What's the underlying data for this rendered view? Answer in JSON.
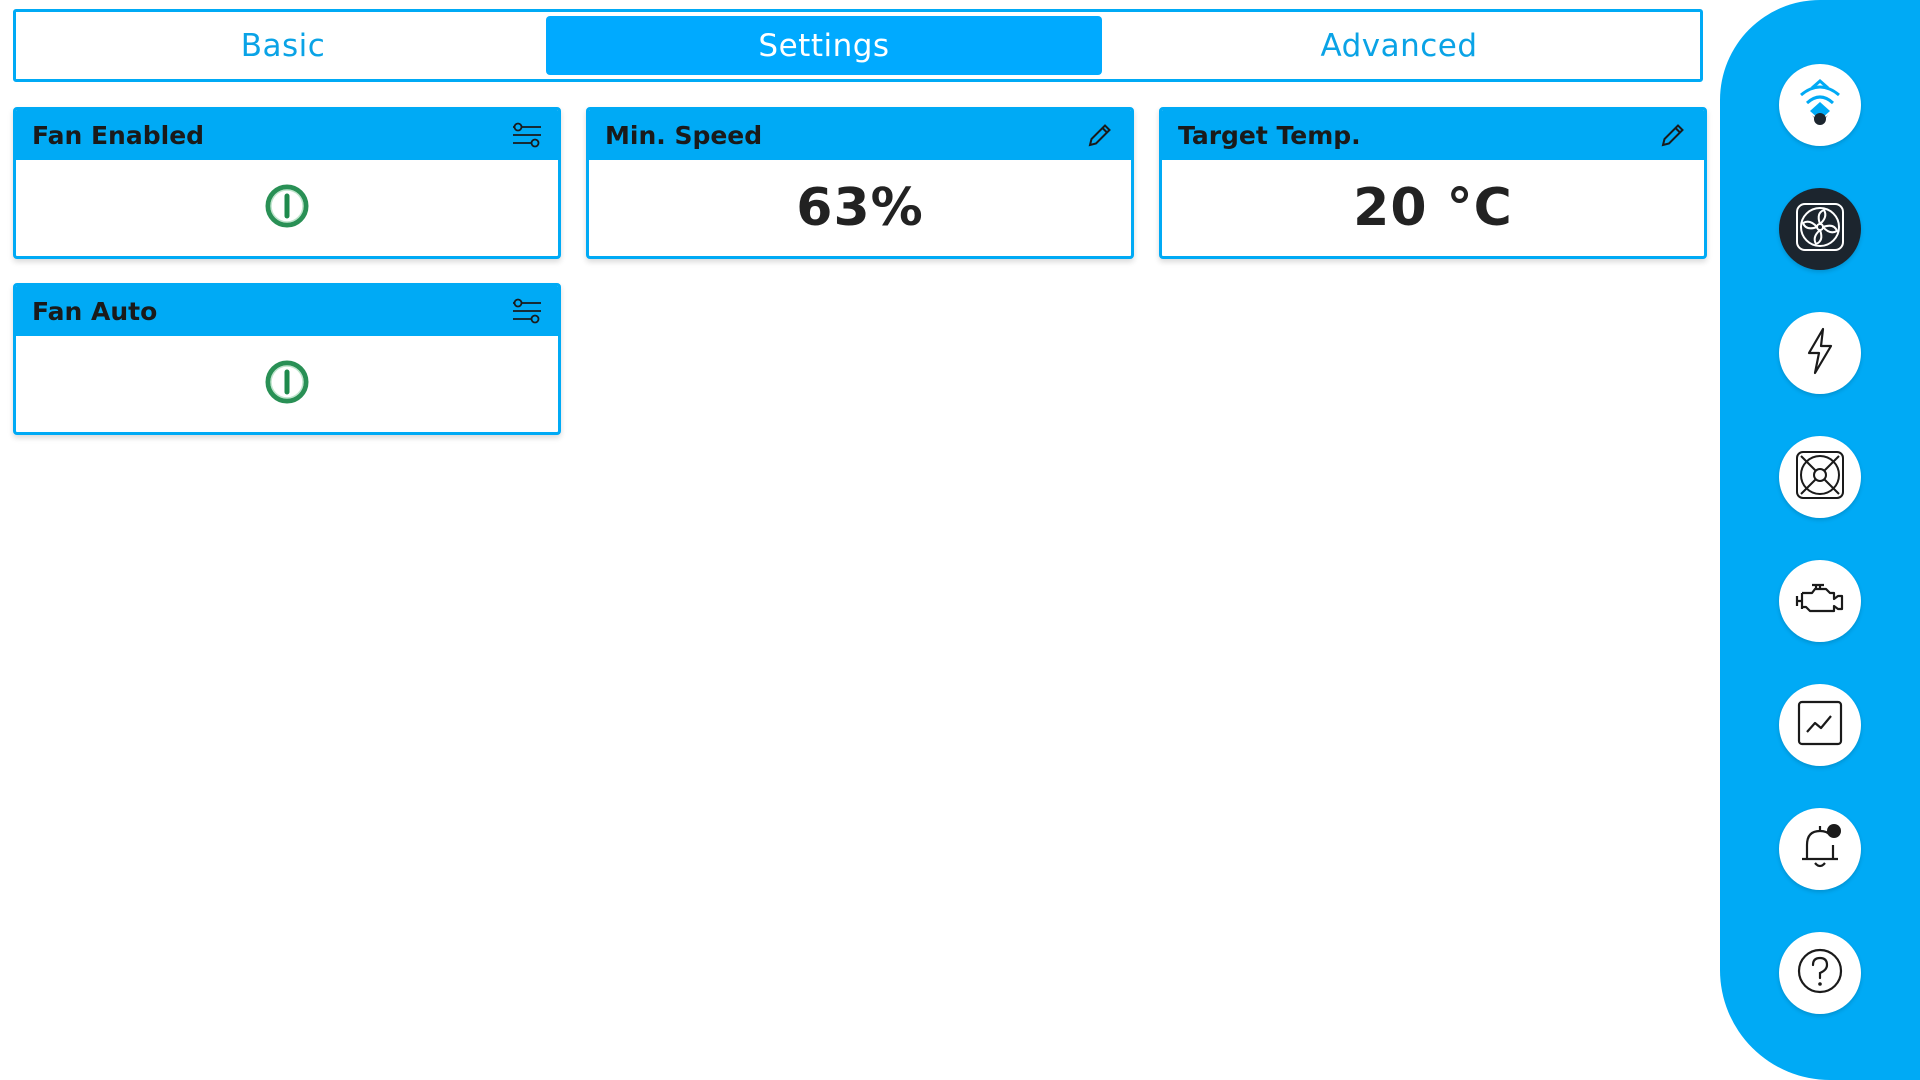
{
  "tabs": [
    {
      "label": "Basic",
      "active": false
    },
    {
      "label": "Settings",
      "active": true
    },
    {
      "label": "Advanced",
      "active": false
    }
  ],
  "cards": {
    "fan_enabled": {
      "title": "Fan Enabled",
      "state": "on",
      "icon": "sliders-icon"
    },
    "min_speed": {
      "title": "Min. Speed",
      "value": "63%",
      "icon": "pencil-icon"
    },
    "target_temp": {
      "title": "Target Temp.",
      "value": "20 °C",
      "icon": "pencil-icon"
    },
    "fan_auto": {
      "title": "Fan Auto",
      "state": "on",
      "icon": "sliders-icon"
    }
  },
  "nav": {
    "items": [
      {
        "icon": "wifi-logo-icon",
        "active": false
      },
      {
        "icon": "fan-icon",
        "active": true
      },
      {
        "icon": "lightning-icon",
        "active": false
      },
      {
        "icon": "fan-grille-icon",
        "active": false
      },
      {
        "icon": "engine-icon",
        "active": false
      },
      {
        "icon": "chart-icon",
        "active": false
      },
      {
        "icon": "bell-icon",
        "active": false
      },
      {
        "icon": "help-icon",
        "active": false
      }
    ]
  },
  "colors": {
    "accent": "#00aaf5",
    "power_on": "#1e8a4c",
    "active_nav": "#1c252e"
  }
}
